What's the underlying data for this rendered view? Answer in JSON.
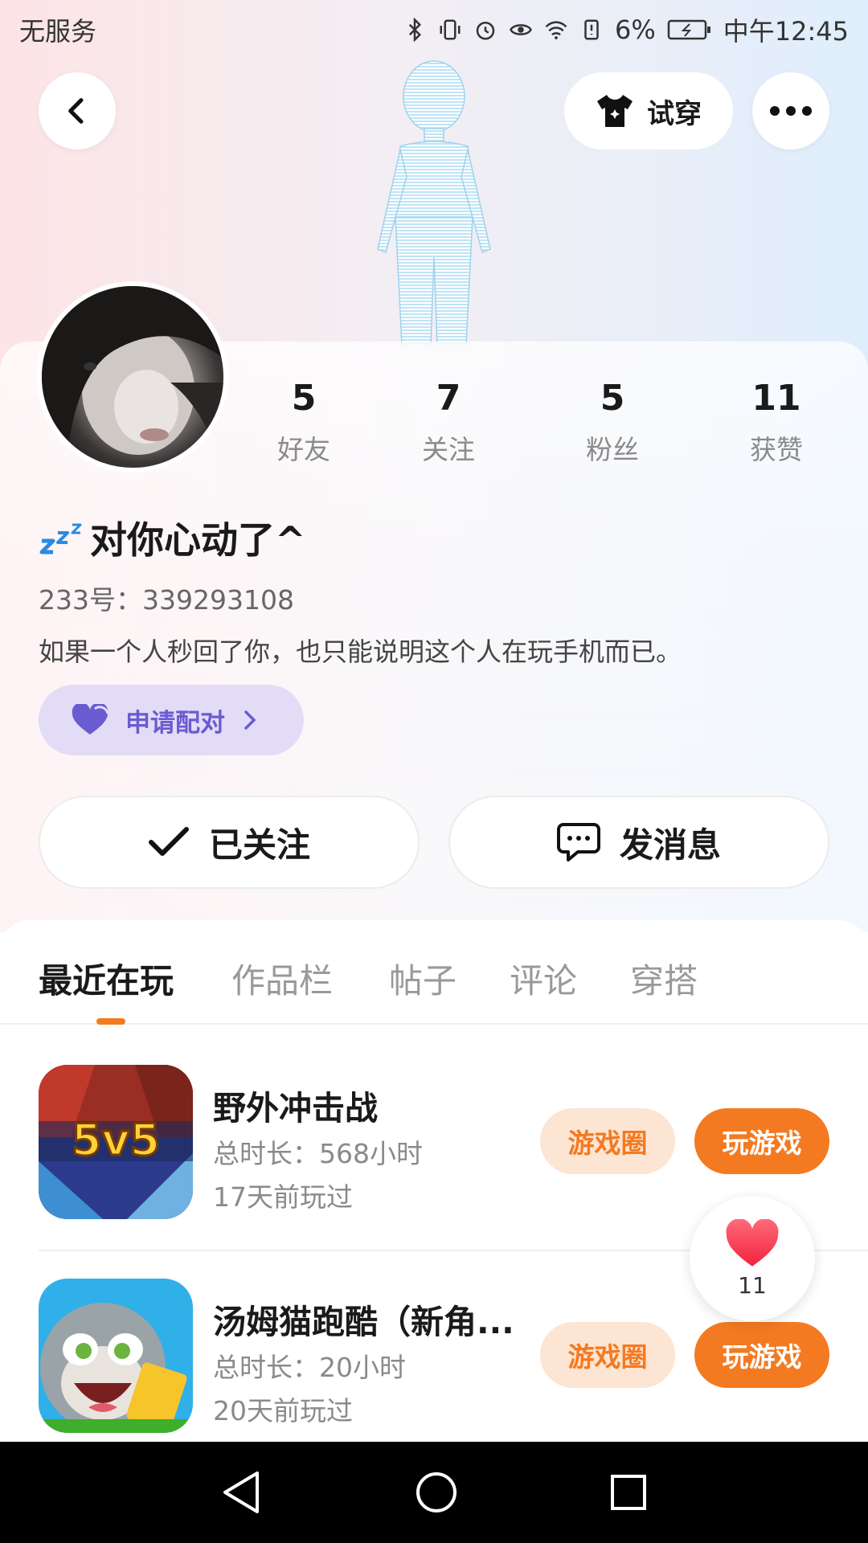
{
  "status_bar": {
    "carrier": "无服务",
    "battery": "6%",
    "time": "中午12:45"
  },
  "header": {
    "tryon_label": "试穿"
  },
  "stats": [
    {
      "value": "5",
      "label": "好友"
    },
    {
      "value": "7",
      "label": "关注"
    },
    {
      "value": "5",
      "label": "粉丝"
    },
    {
      "value": "11",
      "label": "获赞"
    }
  ],
  "profile": {
    "nickname": "对你心动了^",
    "uid": "233号：339293108",
    "bio": "如果一个人秒回了你，也只能说明这个人在玩手机而已。",
    "pair_label": "申请配对",
    "follow_label": "已关注",
    "message_label": "发消息"
  },
  "tabs": [
    {
      "label": "最近在玩",
      "active": true
    },
    {
      "label": "作品栏"
    },
    {
      "label": "帖子"
    },
    {
      "label": "评论"
    },
    {
      "label": "穿搭"
    }
  ],
  "games": [
    {
      "title": "野外冲击战",
      "duration": "总时长：568小时",
      "last_played": "17天前玩过",
      "icon_text": "5v5",
      "circle_label": "游戏圈",
      "play_label": "玩游戏"
    },
    {
      "title": "汤姆猫跑酷（新角...",
      "duration": "总时长：20小时",
      "last_played": "20天前玩过",
      "circle_label": "游戏圈",
      "play_label": "玩游戏"
    }
  ],
  "like_float": {
    "count": "11"
  },
  "colors": {
    "accent": "#f47a21",
    "pair_bg": "#e3dcf7",
    "pair_text": "#6a5bd1"
  }
}
